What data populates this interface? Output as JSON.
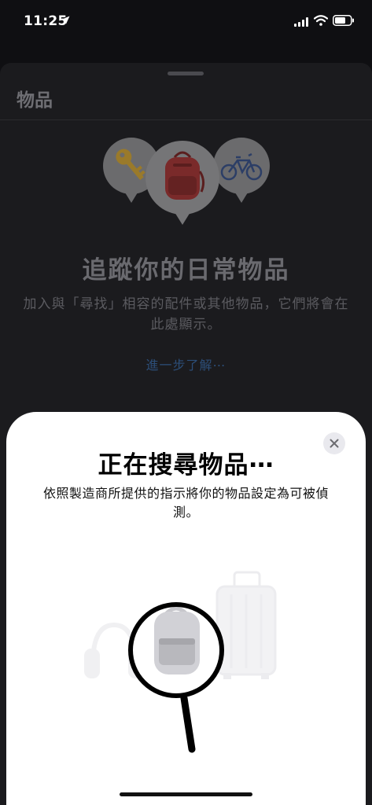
{
  "status_bar": {
    "time": "11:25"
  },
  "background": {
    "title": "物品",
    "headline": "追蹤你的日常物品",
    "description": "加入與「尋找」相容的配件或其他物品，它們將會在此處顯示。",
    "learn_more": "進一步了解⋯",
    "pins": [
      "key-icon",
      "backpack-icon",
      "bicycle-icon"
    ]
  },
  "sheet": {
    "title": "正在搜尋物品⋯",
    "description": "依照製造商所提供的指示將你的物品設定為可被偵測。",
    "illustration": [
      "headphones-icon",
      "backpack-icon",
      "suitcase-icon",
      "magnifier-icon"
    ]
  },
  "colors": {
    "link": "#2c4e78",
    "sheet_bg": "#ffffff",
    "backdrop": "#0f0f12"
  }
}
